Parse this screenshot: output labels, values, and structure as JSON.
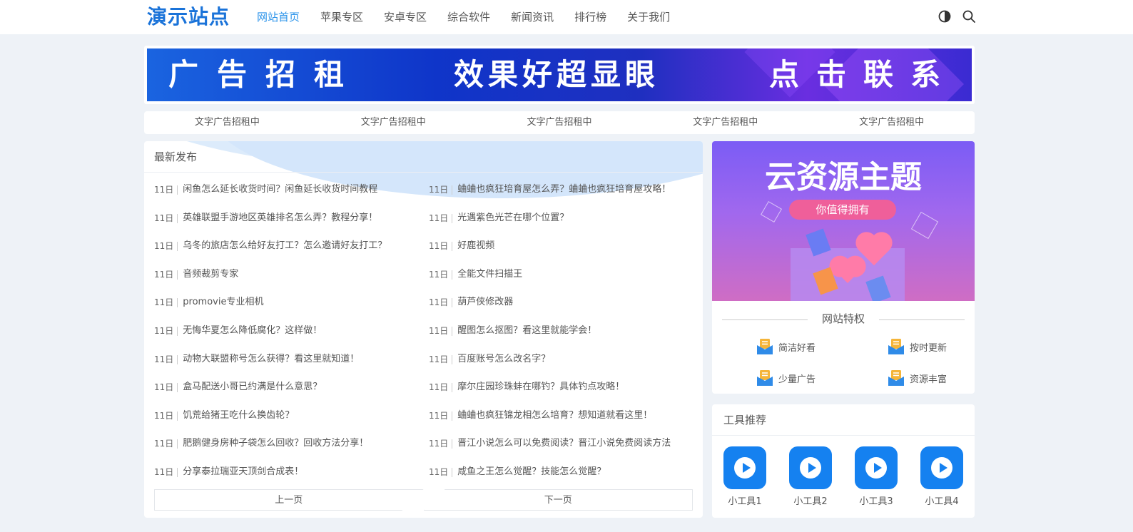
{
  "header": {
    "logo": "演示站点",
    "nav": [
      "网站首页",
      "苹果专区",
      "安卓专区",
      "综合软件",
      "新闻资讯",
      "排行榜",
      "关于我们"
    ],
    "active_nav": 0,
    "icons": [
      "theme-toggle-icon",
      "search-icon"
    ]
  },
  "banner": {
    "text1": "广告招租",
    "text2": "效果好超显眼",
    "text3": "点击联系"
  },
  "text_ads": [
    "文字广告招租中",
    "文字广告招租中",
    "文字广告招租中",
    "文字广告招租中",
    "文字广告招租中"
  ],
  "latest": {
    "title": "最新发布",
    "items": [
      {
        "day": "11日",
        "title": "闲鱼怎么延长收货时间？闲鱼延长收货时间教程"
      },
      {
        "day": "11日",
        "title": "蛐蛐也疯狂培育屋怎么弄？蛐蛐也疯狂培育屋攻略！"
      },
      {
        "day": "11日",
        "title": "英雄联盟手游地区英雄排名怎么弄？教程分享！"
      },
      {
        "day": "11日",
        "title": "光遇紫色光芒在哪个位置？"
      },
      {
        "day": "11日",
        "title": "乌冬的旅店怎么给好友打工？怎么邀请好友打工？"
      },
      {
        "day": "11日",
        "title": "好鹿视频"
      },
      {
        "day": "11日",
        "title": "音频裁剪专家"
      },
      {
        "day": "11日",
        "title": "全能文件扫描王"
      },
      {
        "day": "11日",
        "title": "promovie专业相机"
      },
      {
        "day": "11日",
        "title": "葫芦侠修改器"
      },
      {
        "day": "11日",
        "title": "无悔华夏怎么降低腐化？这样做！"
      },
      {
        "day": "11日",
        "title": "醒图怎么抠图？看这里就能学会！"
      },
      {
        "day": "11日",
        "title": "动物大联盟称号怎么获得？看这里就知道！"
      },
      {
        "day": "11日",
        "title": "百度账号怎么改名字？"
      },
      {
        "day": "11日",
        "title": "盒马配送小哥已约满是什么意思？"
      },
      {
        "day": "11日",
        "title": "摩尔庄园珍珠蚌在哪钓？具体钓点攻略！"
      },
      {
        "day": "11日",
        "title": "饥荒给猪王吃什么换齿轮？"
      },
      {
        "day": "11日",
        "title": "蛐蛐也疯狂锦龙相怎么培育？想知道就看这里！"
      },
      {
        "day": "11日",
        "title": "肥鹅健身房种子袋怎么回收？回收方法分享！"
      },
      {
        "day": "11日",
        "title": "晋江小说怎么可以免费阅读？晋江小说免费阅读方法"
      },
      {
        "day": "11日",
        "title": "分享泰拉瑞亚天顶剑合成表！"
      },
      {
        "day": "11日",
        "title": "咸鱼之王怎么觉醒？技能怎么觉醒？"
      }
    ],
    "prev": "上一页",
    "next": "下一页"
  },
  "promo": {
    "title": "云资源主题",
    "badge": "你值得拥有"
  },
  "privileges": {
    "title": "网站特权",
    "items": [
      "简洁好看",
      "按时更新",
      "少量广告",
      "资源丰富"
    ]
  },
  "tools": {
    "title": "工具推荐",
    "items": [
      "小工具1",
      "小工具2",
      "小工具3",
      "小工具4"
    ]
  },
  "colors": {
    "accent": "#2a93ea",
    "tool_blue": "#1581f0",
    "background": "#eef2f7"
  }
}
